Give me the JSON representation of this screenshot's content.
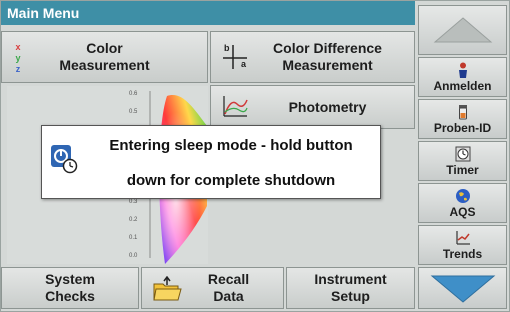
{
  "window": {
    "title": "Main Menu"
  },
  "main": {
    "tiles": [
      {
        "label_line1": "Color",
        "label_line2": "Measurement"
      },
      {
        "label_line1": "Color Difference",
        "label_line2": "Measurement"
      },
      {
        "label_line1": "Photometry"
      }
    ],
    "plot_ticks": [
      "0.6",
      "0.5",
      "0.3",
      "0.2",
      "0.1",
      "0.0"
    ]
  },
  "dialog": {
    "line1": "Entering sleep mode - hold button",
    "line2": "down for complete shutdown"
  },
  "sidebar": {
    "items": [
      {
        "label": "Anmelden",
        "icon": "person-icon"
      },
      {
        "label": "Proben-ID",
        "icon": "sample-vial-icon"
      },
      {
        "label": "Timer",
        "icon": "timer-icon"
      },
      {
        "label": "AQS",
        "icon": "aqs-globe-icon"
      },
      {
        "label": "Trends",
        "icon": "trends-chart-icon"
      }
    ]
  },
  "bottom": {
    "system_checks": {
      "line1": "System",
      "line2": "Checks"
    },
    "recall_data": {
      "line1": "Recall",
      "line2": "Data"
    },
    "instrument_setup": {
      "line1": "Instrument",
      "line2": "Setup"
    }
  },
  "colors": {
    "titlebar": "#3e8fa6",
    "arrow": "#3f8fc8",
    "dialog_icon": "#2f66b3"
  }
}
